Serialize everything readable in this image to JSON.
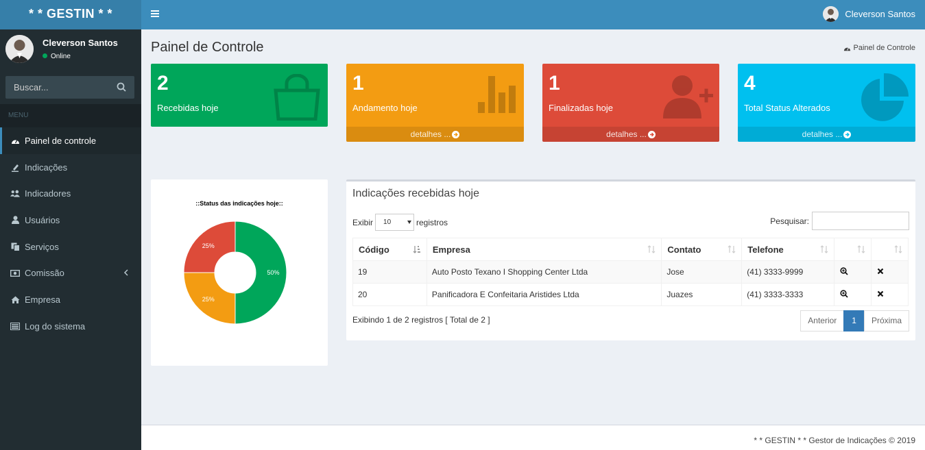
{
  "app": {
    "logo": "* * GESTIN * *"
  },
  "sidebar": {
    "user_name": "Cleverson Santos",
    "user_status": "Online",
    "search_placeholder": "Buscar...",
    "menu_header": "MENU",
    "items": [
      {
        "label": "Painel de controle",
        "icon": "dashboard-icon",
        "active": true
      },
      {
        "label": "Indicações",
        "icon": "pencil-icon"
      },
      {
        "label": "Indicadores",
        "icon": "users-icon"
      },
      {
        "label": "Usuários",
        "icon": "user-icon"
      },
      {
        "label": "Serviços",
        "icon": "copy-icon"
      },
      {
        "label": "Comissão",
        "icon": "money-icon",
        "has_submenu": true
      },
      {
        "label": "Empresa",
        "icon": "home-icon"
      },
      {
        "label": "Log do sistema",
        "icon": "list-icon"
      }
    ]
  },
  "header": {
    "user_name": "Cleverson Santos",
    "toggle_icon": "hamburger-icon"
  },
  "page": {
    "title": "Painel de Controle",
    "breadcrumb": "Painel de Controle"
  },
  "boxes": [
    {
      "number": "2",
      "label": "Recebidas hoje",
      "icon": "shopping-bag-icon",
      "color": "#00a65a",
      "footer": ""
    },
    {
      "number": "1",
      "label": "Andamento hoje",
      "icon": "bar-chart-icon",
      "color": "#f39c12",
      "footer": "detalhes ..."
    },
    {
      "number": "1",
      "label": "Finalizadas hoje",
      "icon": "user-plus-icon",
      "color": "#dd4b39",
      "footer": "detalhes ..."
    },
    {
      "number": "4",
      "label": "Total Status Alterados",
      "icon": "pie-chart-icon",
      "color": "#00c0ef",
      "footer": "detalhes ..."
    }
  ],
  "chart_data": {
    "type": "pie",
    "title": "::Status das indicações hoje::",
    "donut": true,
    "slices": [
      {
        "label": "50%",
        "value": 50,
        "color": "#00a65a"
      },
      {
        "label": "25%",
        "value": 25,
        "color": "#f39c12"
      },
      {
        "label": "25%",
        "value": 25,
        "color": "#dd4b39"
      }
    ]
  },
  "table": {
    "title": "Indicações recebidas hoje",
    "show_label": "Exibir",
    "show_value": "10",
    "records_label": "registros",
    "search_label": "Pesquisar:",
    "columns": [
      "Código",
      "Empresa",
      "Contato",
      "Telefone",
      "",
      ""
    ],
    "rows": [
      {
        "codigo": "19",
        "empresa": "Auto Posto Texano I Shopping Center Ltda",
        "contato": "Jose",
        "telefone": "(41) 3333-9999"
      },
      {
        "codigo": "20",
        "empresa": "Panificadora E Confeitaria Aristides Ltda",
        "contato": "Juazes",
        "telefone": "(41) 3333-3333"
      }
    ],
    "info": "Exibindo 1 de 2 registros [ Total de 2 ]",
    "pager": {
      "prev": "Anterior",
      "current": "1",
      "next": "Próxima"
    }
  },
  "footer": {
    "text": "* * GESTIN * * Gestor de Indicações © 2019"
  }
}
